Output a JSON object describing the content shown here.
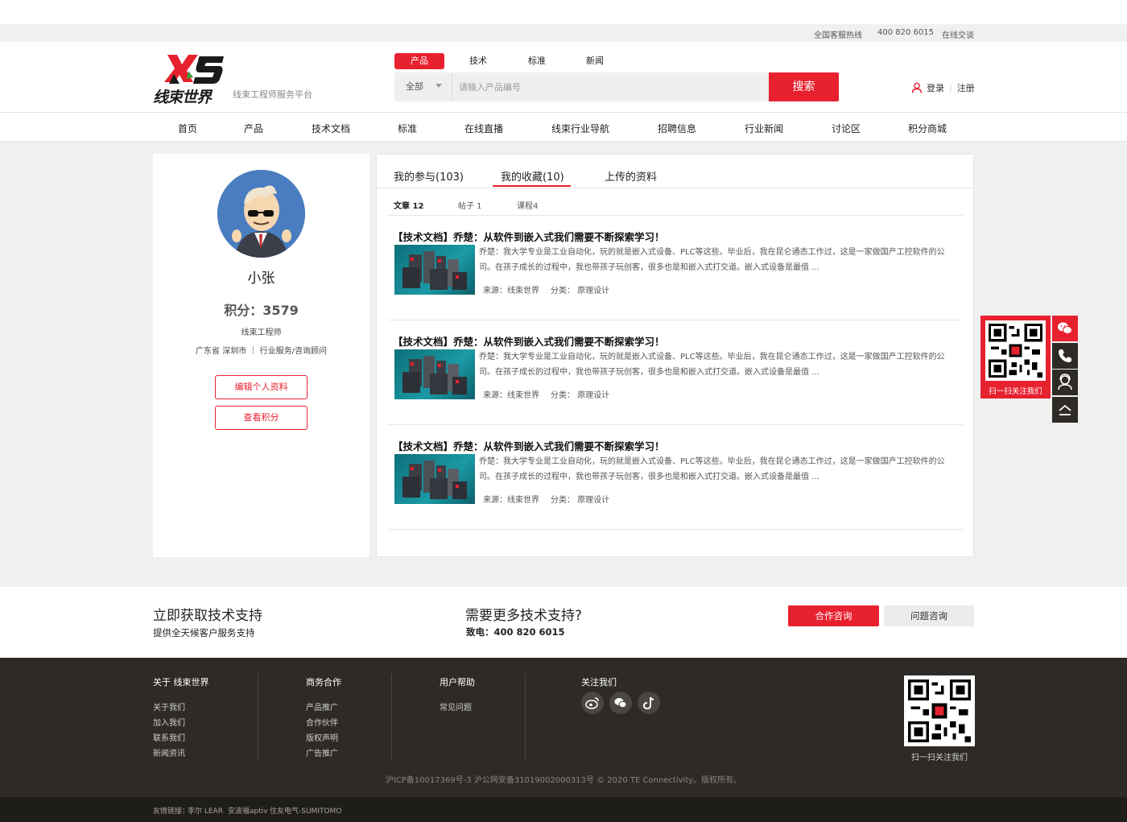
{
  "topbar": {
    "hotline_label": "全国客服热线",
    "hotline_number": "400 820 6015",
    "chat": "在线交谈"
  },
  "header": {
    "logo_text": "XS",
    "logo_name": "线束世界",
    "slogan": "线束工程师服务平台",
    "search_tabs": [
      "产品",
      "技术",
      "标准",
      "新闻"
    ],
    "search_scope": "全部",
    "search_placeholder": "请输入产品编号",
    "search_button": "搜索",
    "login": "登录",
    "register": "注册"
  },
  "nav": [
    "首页",
    "产品",
    "技术文档",
    "标准",
    "在线直播",
    "线束行业导航",
    "招聘信息",
    "行业新闻",
    "讨论区",
    "积分商城"
  ],
  "profile": {
    "name": "小张",
    "points": "积分：3579",
    "role": "线束工程师",
    "location": "广东省 深圳市  ｜  行业服务/咨询顾问",
    "edit_button": "编辑个人资料",
    "points_button": "查看积分"
  },
  "main_tabs": [
    "我的参与(103)",
    "我的收藏(10)",
    "上传的资料"
  ],
  "sub_tabs": [
    "文章 12",
    "帖子 1",
    "课程4"
  ],
  "articles": [
    {
      "title": "【技术文档】乔楚：从软件到嵌入式我们需要不断探索学习！",
      "excerpt": "乔楚：我大学专业是工业自动化，玩的就是嵌入式设备、PLC等这些。毕业后，我在昆仑通态工作过，这是一家做国产工控软件的公司。在孩子成长的过程中，我也带孩子玩创客，很多也是和嵌入式打交道。嵌入式设备是最值 ...",
      "source": "来源：线束世界",
      "category": "分类：  原理设计"
    },
    {
      "title": "【技术文档】乔楚：从软件到嵌入式我们需要不断探索学习！",
      "excerpt": "乔楚：我大学专业是工业自动化，玩的就是嵌入式设备、PLC等这些。毕业后，我在昆仑通态工作过，这是一家做国产工控软件的公司。在孩子成长的过程中，我也带孩子玩创客，很多也是和嵌入式打交道。嵌入式设备是最值 ...",
      "source": "来源：线束世界",
      "category": "分类：  原理设计"
    },
    {
      "title": "【技术文档】乔楚：从软件到嵌入式我们需要不断探索学习！",
      "excerpt": "乔楚：我大学专业是工业自动化，玩的就是嵌入式设备、PLC等这些。毕业后，我在昆仑通态工作过，这是一家做国产工控软件的公司。在孩子成长的过程中，我也带孩子玩创客，很多也是和嵌入式打交道。嵌入式设备是最值 ...",
      "source": "来源：线束世界",
      "category": "分类：  原理设计"
    }
  ],
  "side_float": {
    "qr_label": "扫一扫关注我们"
  },
  "support": {
    "title1": "立即获取技术支持",
    "sub1": "提供全天候客户服务支持",
    "title2": "需要更多技术支持?",
    "sub2": "致电：400 820 6015",
    "btn_coop": "合作咨询",
    "btn_question": "问题咨询"
  },
  "footer": {
    "col1": {
      "title": "关于 线束世界",
      "links": [
        "关于我们",
        "加入我们",
        "联系我们",
        "新闻资讯"
      ]
    },
    "col2": {
      "title": "商务合作",
      "links": [
        "产品推广",
        "合作伙伴",
        "版权声明",
        "广告推广"
      ]
    },
    "col3": {
      "title": "用户帮助",
      "links": [
        "常见问题"
      ]
    },
    "col4": {
      "title": "关注我们"
    },
    "qr_label": "扫一扫关注我们",
    "copyright": "沪ICP备10017369号-3  沪公网安备31019002000313号  © 2020 TE Connectivity。版权所有。"
  },
  "links_bar": {
    "label": "友情链接：",
    "links": [
      "李尔 LEAR",
      "安波福aptiv",
      "住友电气-SUMITOMO"
    ]
  },
  "colors": {
    "brand_red": "#e8212f",
    "footer_bg": "#2e2b27"
  }
}
